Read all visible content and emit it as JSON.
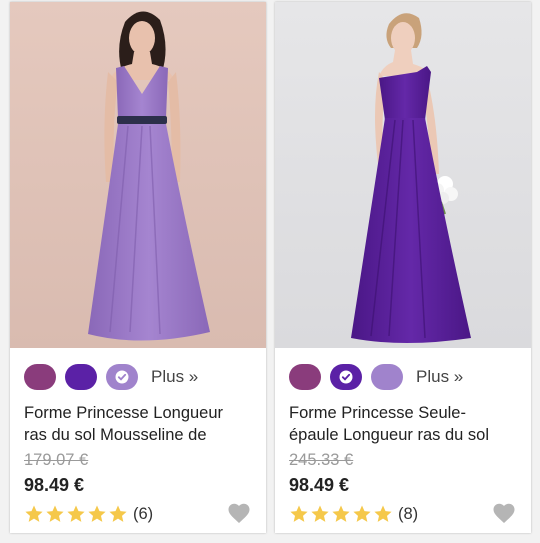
{
  "products": [
    {
      "title_lines": [
        "Forme Princesse Longueur",
        "ras du sol Mousseline de"
      ],
      "old_price": "179.07 €",
      "price": "98.49 €",
      "rating_count": "(6)",
      "more_label": "Plus »",
      "swatches": [
        {
          "color": "#8a3c7c",
          "selected": false
        },
        {
          "color": "#5b21a6",
          "selected": false
        },
        {
          "color": "#a083cc",
          "selected": true
        }
      ],
      "rating": 5
    },
    {
      "title_lines": [
        "Forme Princesse Seule-",
        "épaule Longueur ras du sol"
      ],
      "old_price": "245.33 €",
      "price": "98.49 €",
      "rating_count": "(8)",
      "more_label": "Plus »",
      "swatches": [
        {
          "color": "#8a3c7c",
          "selected": false
        },
        {
          "color": "#5b21a6",
          "selected": true
        },
        {
          "color": "#a083cc",
          "selected": false
        }
      ],
      "rating": 5
    }
  ],
  "colors": {
    "star": "#f5c84a",
    "heart": "#b5b5b5",
    "dress1": "#9a7ac4",
    "dress2": "#5a1f9a"
  }
}
